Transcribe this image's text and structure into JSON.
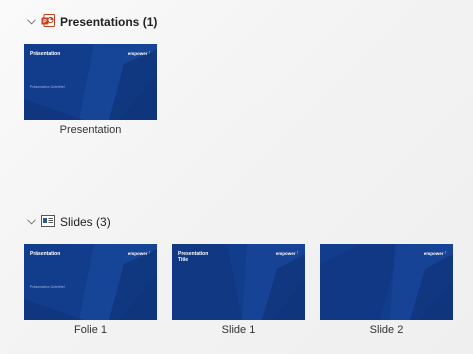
{
  "sections": {
    "presentations": {
      "title": "Presentations (1)",
      "icon": "powerpoint-icon",
      "items": [
        {
          "caption": "Presentation",
          "thumb_title": "Präsentation",
          "thumb_subtitle": "Präsentation Untertitel",
          "logo": "empower"
        }
      ]
    },
    "slides": {
      "title": "Slides (3)",
      "icon": "slide-icon",
      "items": [
        {
          "caption": "Folie 1",
          "thumb_title": "Präsentation",
          "thumb_subtitle": "Präsentation Untertitel",
          "logo": "empower"
        },
        {
          "caption": "Slide 1",
          "thumb_title": "Presentation\nTitle",
          "thumb_subtitle": "",
          "logo": "empower"
        },
        {
          "caption": "Slide 2",
          "thumb_title": "",
          "thumb_subtitle": "",
          "logo": "empower"
        }
      ]
    }
  },
  "colors": {
    "thumb_bg": "#123c8c",
    "powerpoint_accent": "#c43e1c",
    "slide_icon_accent": "#2f5597"
  }
}
